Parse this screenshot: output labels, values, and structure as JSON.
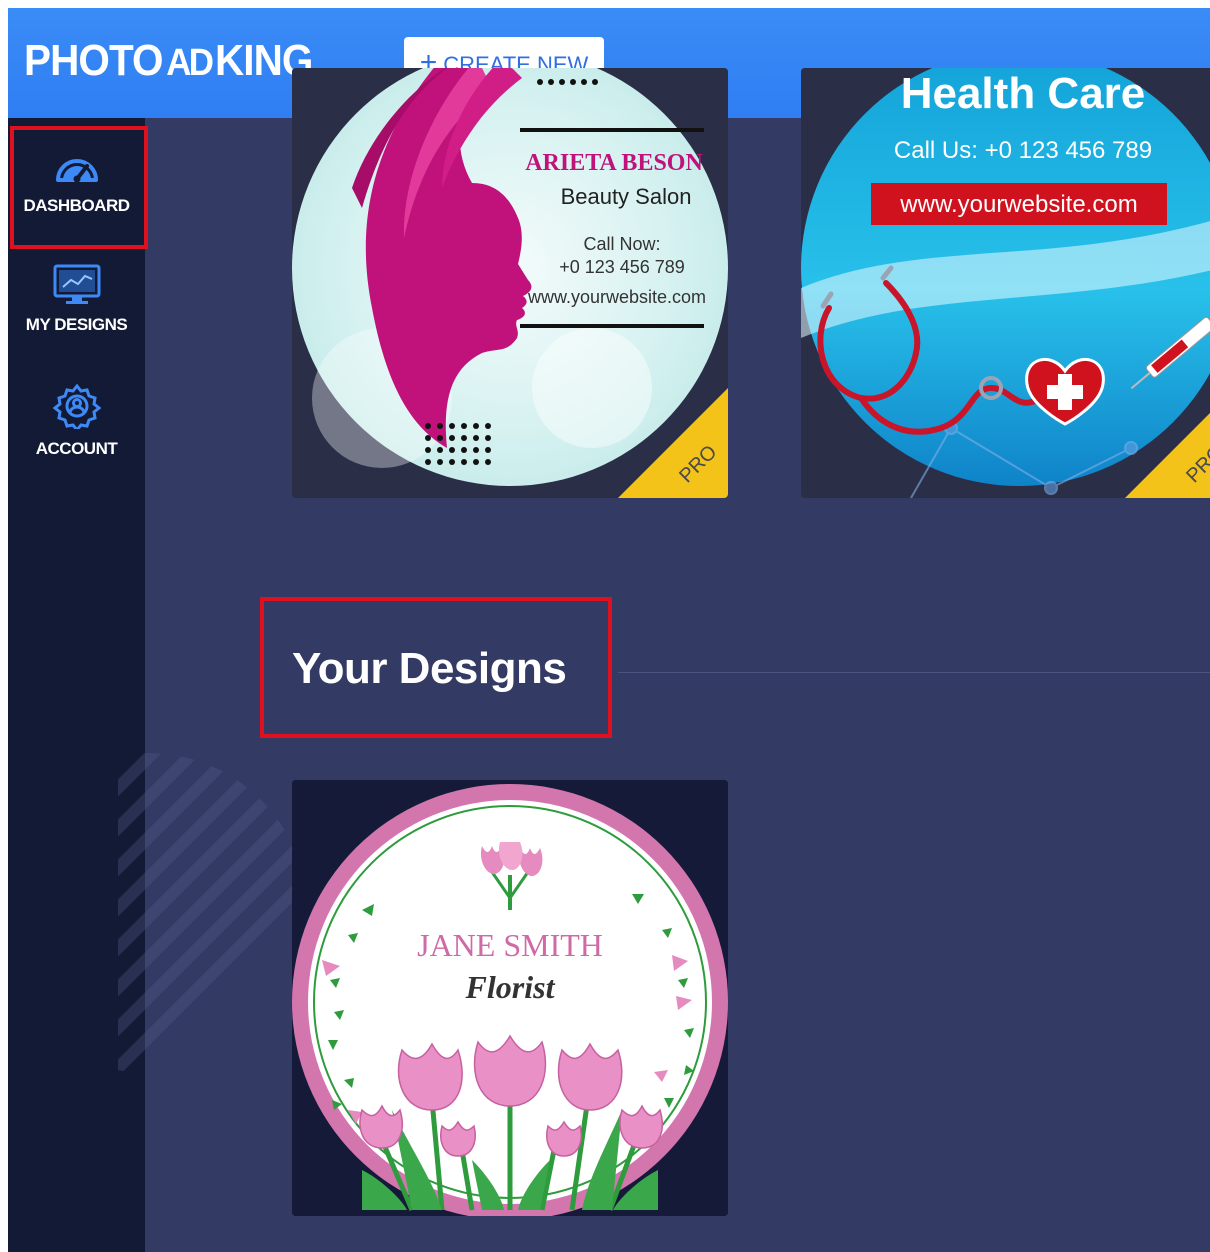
{
  "header": {
    "logo_left": "PHOTO",
    "logo_mid": "AD",
    "logo_right": "KING",
    "create_button": "CREATE NEW",
    "colors": {
      "header_bg": "#3a8cf6",
      "accent": "#2f6fe0"
    }
  },
  "sidebar": {
    "items": [
      {
        "label": "DASHBOARD",
        "icon": "speedometer-icon"
      },
      {
        "label": "MY DESIGNS",
        "icon": "monitor-chart-icon",
        "highlighted": true
      },
      {
        "label": "ACCOUNT",
        "icon": "gear-user-icon"
      }
    ]
  },
  "templates": [
    {
      "name": "ARIETA BESON",
      "subtitle": "Beauty Salon",
      "call_label": "Call Now:",
      "phone": "+0 123 456 789",
      "website": "www.yourwebsite.com",
      "badge": "PRO"
    },
    {
      "title": "Health Care",
      "phone_line": "Call Us: +0 123 456 789",
      "website": "www.yourwebsite.com",
      "badge": "PRO"
    }
  ],
  "your_designs": {
    "heading": "Your Designs",
    "items": [
      {
        "name": "JANE SMITH",
        "role": "Florist"
      }
    ]
  }
}
